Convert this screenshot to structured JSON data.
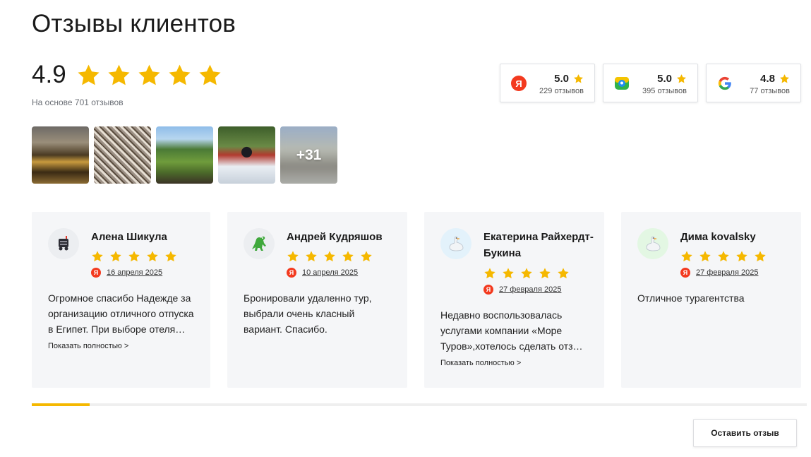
{
  "header": {
    "title": "Отзывы клиентов"
  },
  "summary": {
    "rating": "4.9",
    "stars_value": 4.9,
    "stars_max": 5,
    "based_on": "На основе 701 отзывов"
  },
  "platforms": [
    {
      "icon": "yandex-logo-icon",
      "rating": "5.0",
      "count": "229 отзывов"
    },
    {
      "icon": "2gis-logo-icon",
      "rating": "5.0",
      "count": "395 отзывов"
    },
    {
      "icon": "google-logo-icon",
      "rating": "4.8",
      "count": "77 отзывов"
    }
  ],
  "photos": {
    "more_label": "+31"
  },
  "reviews": [
    {
      "name": "Алена Шикула",
      "avatar": "robot-avatar-icon",
      "stars": 5,
      "source_icon": "yandex-icon",
      "date": "16 апреля 2025",
      "text": "Огромное спасибо Надежде за организацию отличного отпуска в Египет. При выборе отеля Надежда учла все наши пожелания.",
      "more": "Показать полностью >"
    },
    {
      "name": "Андрей Кудряшов",
      "avatar": "dinosaur-avatar-icon",
      "stars": 5,
      "source_icon": "yandex-icon",
      "date": "10 апреля 2025",
      "text": "Бронировали удаленно тур, выбрали очень класный вариант. Спасибо.",
      "more": ""
    },
    {
      "name": "Екатерина Райхердт-Букина",
      "avatar": "goose-avatar-icon",
      "stars": 5,
      "source_icon": "yandex-icon",
      "date": "27 февраля 2025",
      "text": "Недавно воспользовалась услугами компании «Море Туров»,хотелось сделать отзыв о проделанной работе.",
      "more": "Показать полностью >"
    },
    {
      "name": "Дима kovalsky",
      "avatar": "goose-avatar-icon",
      "stars": 5,
      "source_icon": "yandex-icon",
      "date": "27 февраля 2025",
      "text": "Отличное турагентства",
      "more": ""
    }
  ],
  "carousel": {
    "progress": 0.075
  },
  "actions": {
    "leave_review": "Оставить отзыв"
  },
  "colors": {
    "star": "#f5b800",
    "yandex": "#f33a1f",
    "card_bg": "#f5f6f8"
  }
}
